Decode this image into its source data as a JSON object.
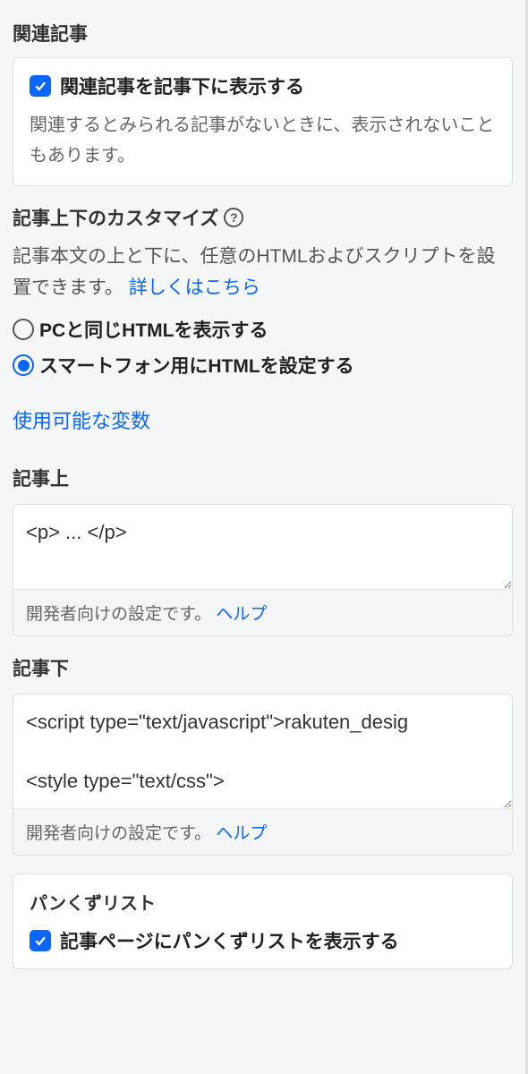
{
  "related": {
    "title": "関連記事",
    "checkbox_label": "関連記事を記事下に表示する",
    "description": "関連するとみられる記事がないときに、表示されないこともあります。"
  },
  "customize": {
    "title": "記事上下のカスタマイズ",
    "body_prefix": "記事本文の上と下に、任意のHTMLおよびスクリプトを設置できます。",
    "details_link": "詳しくはこちら",
    "radio_pc_label": "PCと同じHTMLを表示する",
    "radio_sp_label": "スマートフォン用にHTMLを設定する",
    "variables_link": "使用可能な変数"
  },
  "above": {
    "heading": "記事上",
    "value": "<p> ... </p>",
    "footer_text": "開発者向けの設定です。",
    "help_link": "ヘルプ"
  },
  "below": {
    "heading": "記事下",
    "value": "<script type=\"text/javascript\">rakuten_desig\n\n<style type=\"text/css\">",
    "footer_text": "開発者向けの設定です。",
    "help_link": "ヘルプ"
  },
  "breadcrumb": {
    "heading": "パンくずリスト",
    "checkbox_label": "記事ページにパンくずリストを表示する"
  }
}
